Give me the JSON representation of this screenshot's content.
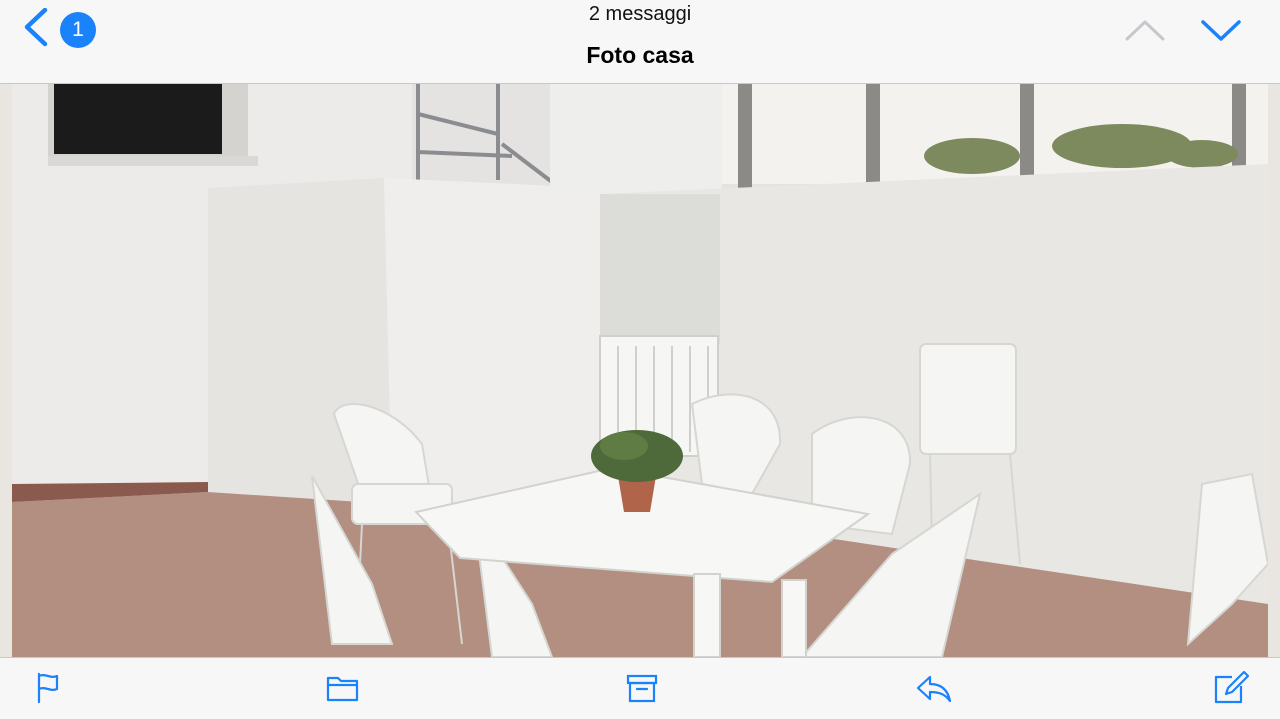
{
  "header": {
    "unread_badge": "1",
    "message_count": "2 messaggi",
    "subject": "Foto casa"
  },
  "colors": {
    "accent": "#1a82fb",
    "disabled": "#c7c7cc"
  },
  "icons": {
    "back": "chevron-left-icon",
    "previous": "chevron-up-icon",
    "next": "chevron-down-icon",
    "toolbar": [
      "flag-icon",
      "folder-icon",
      "archive-icon",
      "reply-icon",
      "compose-icon"
    ]
  }
}
